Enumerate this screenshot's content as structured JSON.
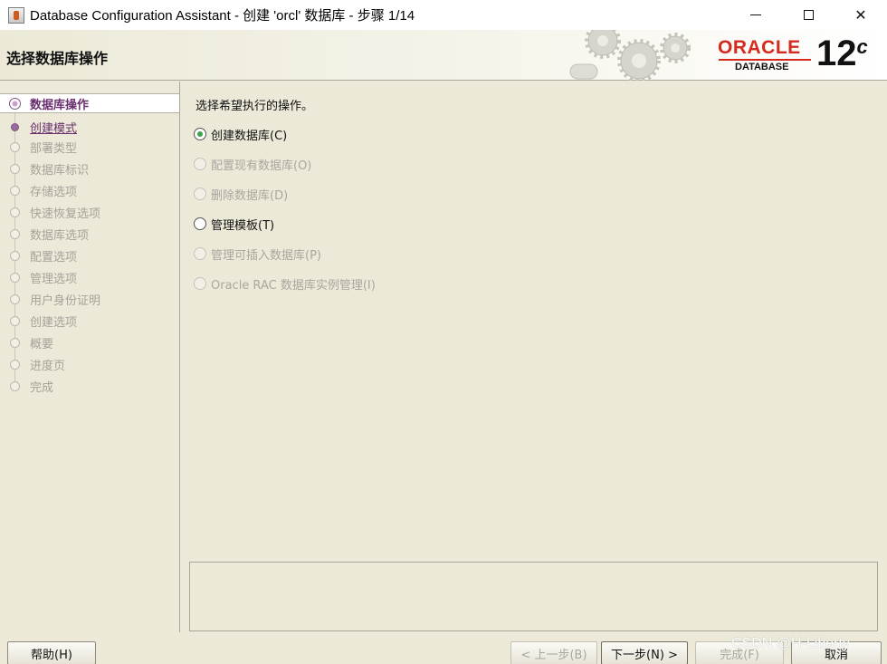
{
  "window": {
    "title": "Database Configuration Assistant - 创建 'orcl' 数据库 - 步骤 1/14",
    "minimize_glyph": "",
    "maximize_glyph": "",
    "close_glyph": "✕"
  },
  "header": {
    "page_title": "选择数据库操作",
    "brand_word": "ORACLE",
    "brand_sub": "DATABASE",
    "version_num": "12",
    "version_suffix": "c",
    "brand_color": "#d32b1e"
  },
  "steps": [
    {
      "label": "数据库操作",
      "state": "active"
    },
    {
      "label": "创建模式",
      "state": "next"
    },
    {
      "label": "部署类型",
      "state": "disabled"
    },
    {
      "label": "数据库标识",
      "state": "disabled"
    },
    {
      "label": "存储选项",
      "state": "disabled"
    },
    {
      "label": "快速恢复选项",
      "state": "disabled"
    },
    {
      "label": "数据库选项",
      "state": "disabled"
    },
    {
      "label": "配置选项",
      "state": "disabled"
    },
    {
      "label": "管理选项",
      "state": "disabled"
    },
    {
      "label": "用户身份证明",
      "state": "disabled"
    },
    {
      "label": "创建选项",
      "state": "disabled"
    },
    {
      "label": "概要",
      "state": "disabled"
    },
    {
      "label": "进度页",
      "state": "disabled"
    },
    {
      "label": "完成",
      "state": "disabled"
    }
  ],
  "main": {
    "prompt": "选择希望执行的操作。",
    "options": [
      {
        "label": "创建数据库(C)",
        "checked": true,
        "enabled": true
      },
      {
        "label": "配置现有数据库(O)",
        "checked": false,
        "enabled": false
      },
      {
        "label": "删除数据库(D)",
        "checked": false,
        "enabled": false
      },
      {
        "label": "管理模板(T)",
        "checked": false,
        "enabled": true
      },
      {
        "label": "管理可插入数据库(P)",
        "checked": false,
        "enabled": false
      },
      {
        "label": "Oracle RAC 数据库实例管理(I)",
        "checked": false,
        "enabled": false
      }
    ],
    "radio_checked_color": "#3fa34d"
  },
  "buttons": {
    "help": "帮助(H)",
    "back": "< 上一步(B)",
    "next": "下一步(N) >",
    "finish": "完成(F)",
    "cancel": "取消"
  },
  "watermark": "CSDN @H-Liberty"
}
